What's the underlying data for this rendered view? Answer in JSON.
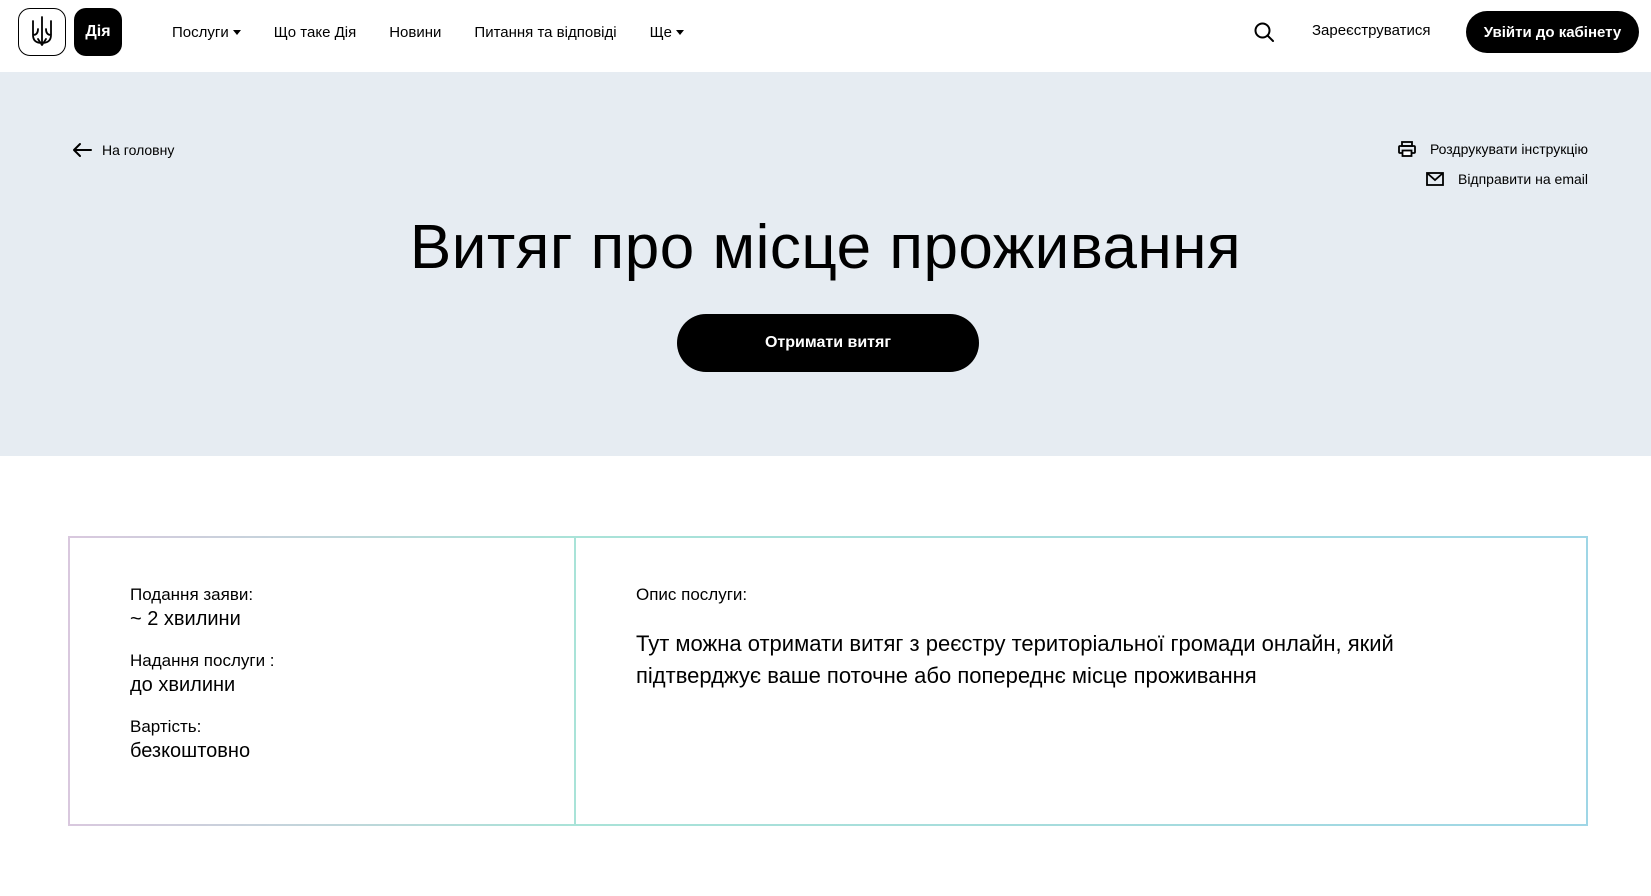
{
  "header": {
    "logo_text": "Дія",
    "nav": [
      {
        "label": "Послуги",
        "dropdown": true
      },
      {
        "label": "Що таке Дія",
        "dropdown": false
      },
      {
        "label": "Новини",
        "dropdown": false
      },
      {
        "label": "Питання та відповіді",
        "dropdown": false
      },
      {
        "label": "Ще",
        "dropdown": true
      }
    ],
    "register_label": "Зареєструватися",
    "login_label": "Увійти до кабінету"
  },
  "hero": {
    "back_label": "На головну",
    "print_label": "Роздрукувати інструкцію",
    "email_label": "Відправити на email",
    "title": "Витяг про місце проживання",
    "cta_label": "Отримати витяг",
    "bg_color": "#e6ecf2"
  },
  "info": {
    "items": [
      {
        "label": "Подання заяви:",
        "value": "~ 2 хвилини"
      },
      {
        "label": "Надання послуги :",
        "value": "до хвилини"
      },
      {
        "label": "Вартість:",
        "value": "безкоштовно"
      }
    ],
    "description_label": "Опис послуги:",
    "description_text": "Тут можна отримати витяг з реєстру територіальної громади онлайн, який підтверджує ваше поточне або попереднє місце проживання"
  }
}
